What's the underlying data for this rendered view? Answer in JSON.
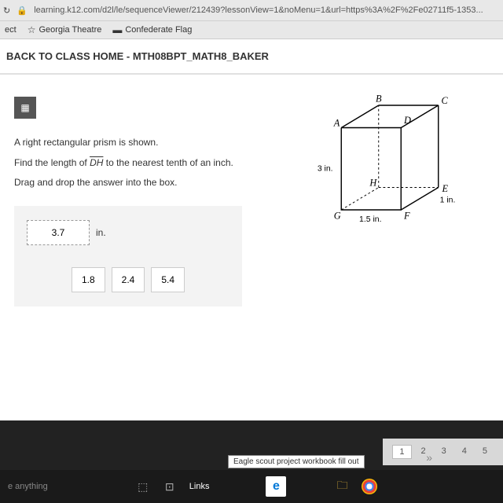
{
  "browser": {
    "url": "learning.k12.com/d2l/le/sequenceViewer/212439?lessonView=1&noMenu=1&url=https%3A%2F%2Fe02711f5-1353...",
    "bookmarks": {
      "ect": "ect",
      "georgia": "Georgia Theatre",
      "confederate": "Confederate Flag"
    }
  },
  "header": {
    "back_link": "BACK TO CLASS HOME - MTH08BPT_MATH8_BAKER"
  },
  "question": {
    "line1": "A right rectangular prism is shown.",
    "line2_pre": "Find the length of ",
    "line2_seg": "DH",
    "line2_post": " to the nearest tenth of an inch.",
    "line3": "Drag and drop the answer into the box."
  },
  "answer": {
    "dropped_value": "3.7",
    "unit": "in.",
    "options": [
      "1.8",
      "2.4",
      "5.4"
    ]
  },
  "figure": {
    "vertices": {
      "A": "A",
      "B": "B",
      "C": "C",
      "D": "D",
      "E": "E",
      "F": "F",
      "G": "G",
      "H": "H"
    },
    "dims": {
      "height": "3 in.",
      "depth": "1 in.",
      "width": "1.5 in."
    }
  },
  "pager": {
    "pages": [
      "1",
      "2",
      "3",
      "4",
      "5"
    ]
  },
  "taskbar": {
    "search": "e anything",
    "links": "Links",
    "tooltip": "Eagle scout project workbook fill out"
  }
}
